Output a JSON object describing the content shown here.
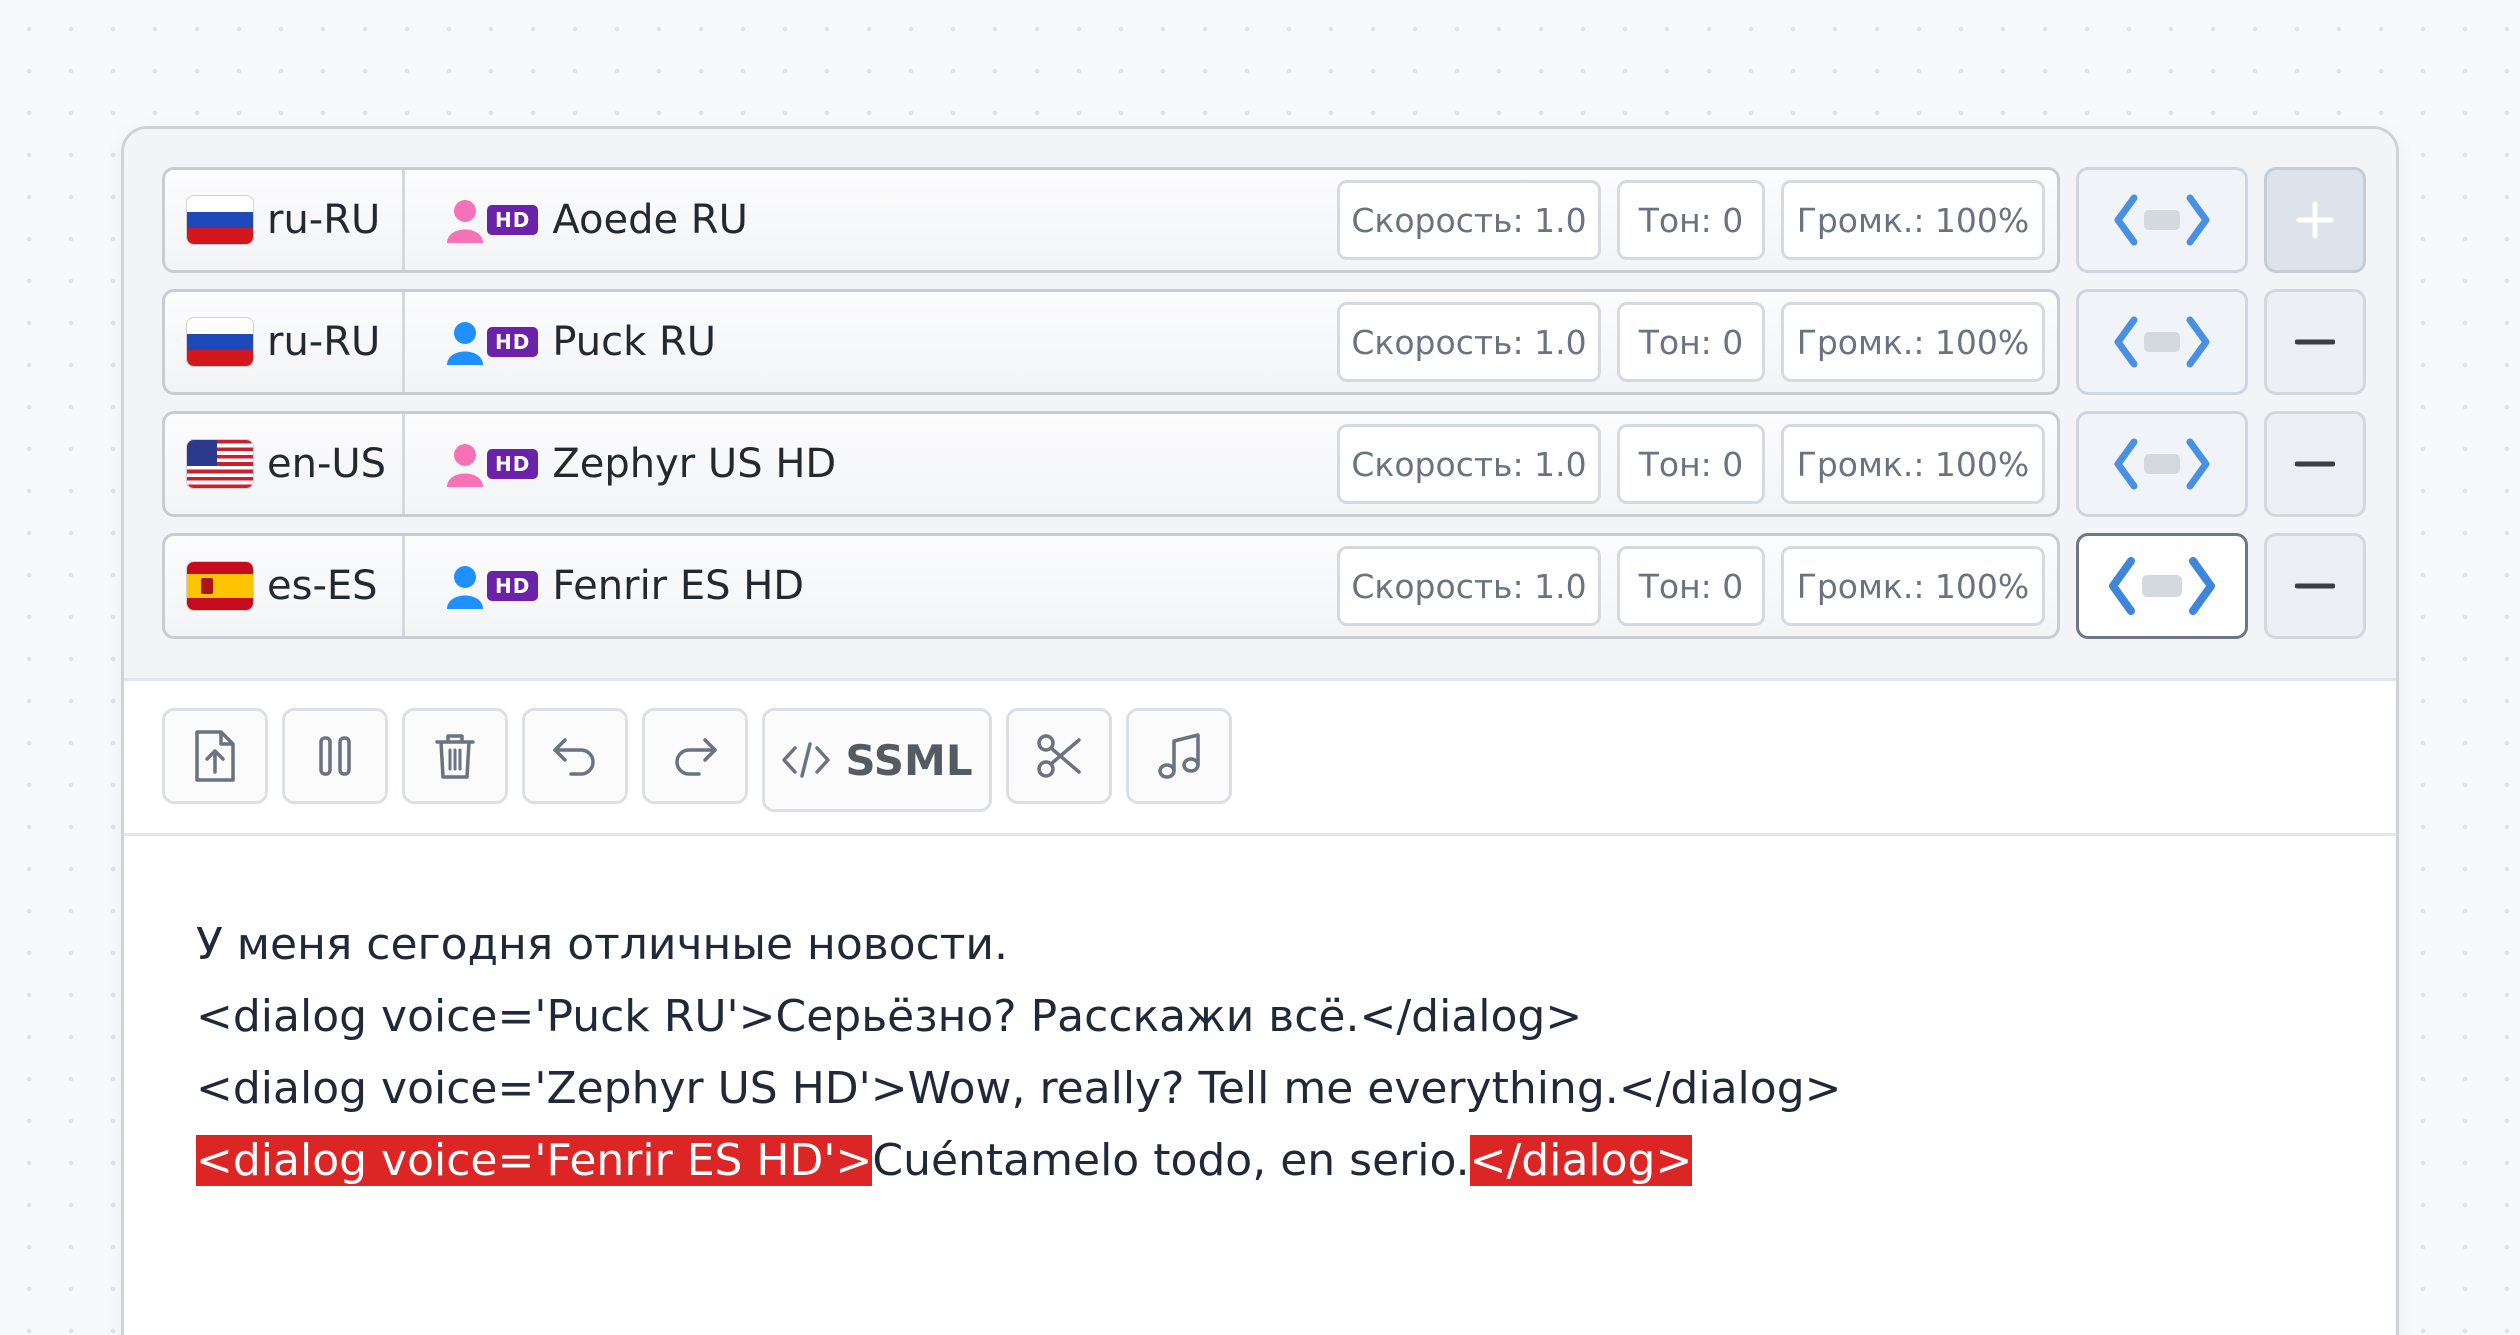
{
  "voices": [
    {
      "flag": "ru-flag",
      "lang": "ru-RU",
      "gender": "female",
      "gender_color": "#f472b6",
      "hd": "HD",
      "name": "Aoede RU",
      "speed": "Скорость: 1.0",
      "tone": "Тон: 0",
      "volume": "Громк.: 100%",
      "action": "+",
      "ssml_active": false
    },
    {
      "flag": "ru-flag",
      "lang": "ru-RU",
      "gender": "male",
      "gender_color": "#1e90ff",
      "hd": "HD",
      "name": "Puck RU",
      "speed": "Скорость: 1.0",
      "tone": "Тон: 0",
      "volume": "Громк.: 100%",
      "action": "−",
      "ssml_active": false
    },
    {
      "flag": "us-flag",
      "lang": "en-US",
      "gender": "female",
      "gender_color": "#f472b6",
      "hd": "HD",
      "name": "Zephyr US HD",
      "speed": "Скорость: 1.0",
      "tone": "Тон: 0",
      "volume": "Громк.: 100%",
      "action": "−",
      "ssml_active": false
    },
    {
      "flag": "es-flag",
      "lang": "es-ES",
      "gender": "male",
      "gender_color": "#1e90ff",
      "hd": "HD",
      "name": "Fenrir ES HD",
      "speed": "Скорость: 1.0",
      "tone": "Тон: 0",
      "volume": "Громк.: 100%",
      "action": "−",
      "ssml_active": true
    }
  ],
  "toolbar": {
    "icons": [
      "upload-icon",
      "pause-icon",
      "trash-icon",
      "undo-icon",
      "redo-icon",
      "code-icon",
      "scissors-icon",
      "music-note-icon"
    ],
    "ssml_label": "SSML"
  },
  "editor": {
    "line1": "У меня сегодня отличные новости.",
    "line2": "<dialog voice='Puck RU'>Серьёзно? Расскажи всё.</dialog>",
    "line3": "<dialog voice='Zephyr US HD'>Wow, really? Tell me everything.</dialog>",
    "line4_open_tag": "<dialog voice='Fenrir ES HD'>",
    "line4_text": "Cuéntamelo todo, en serio.",
    "line4_close_tag": "</dialog>",
    "highlight_color": "#dc2626"
  },
  "colors": {
    "accent_blue": "#4a90e2",
    "hd_purple": "#6b21a8"
  }
}
